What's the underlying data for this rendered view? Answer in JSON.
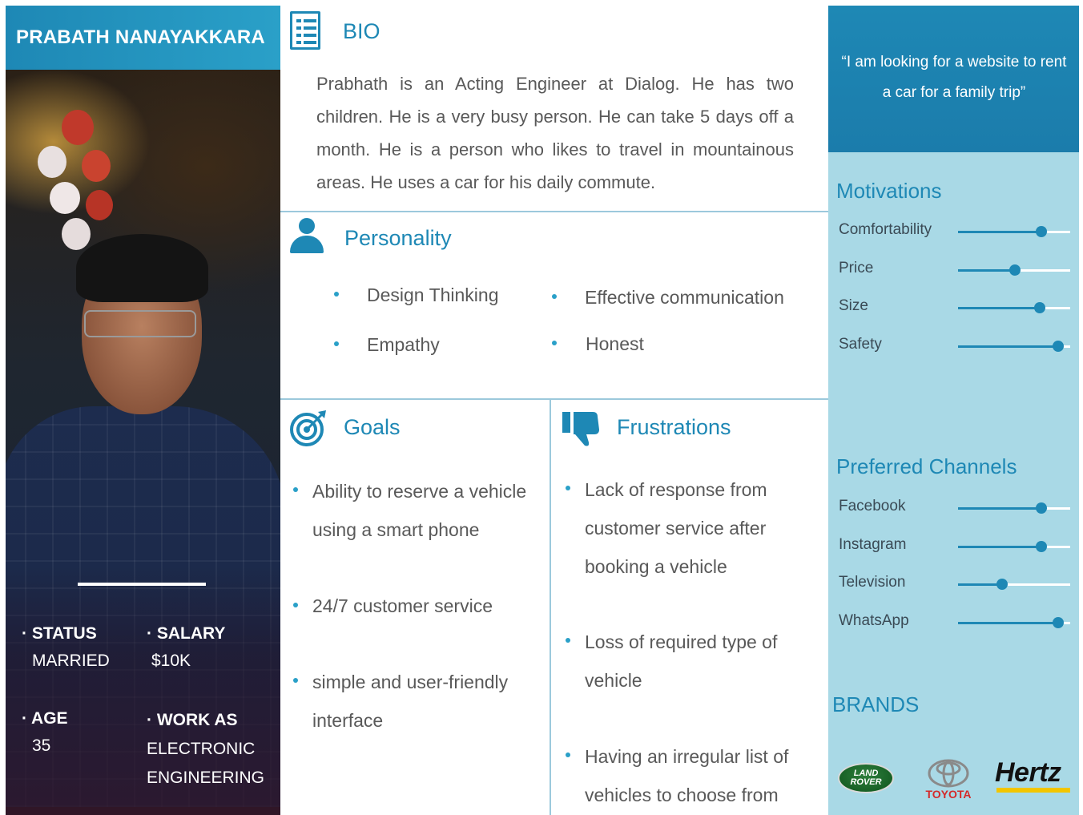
{
  "persona": {
    "name": "PRABATH NANAYAKKARA",
    "status_label": "· STATUS",
    "status_value": "MARRIED",
    "salary_label": "· SALARY",
    "salary_value": "$10K",
    "age_label": "· AGE",
    "age_value": "35",
    "work_label": "· WORK AS",
    "work_value_1": "ELECTRONIC",
    "work_value_2": "ENGINEERING"
  },
  "bio": {
    "title": "BIO",
    "text": "Prabhath is an Acting Engineer at Dialog. He has two children. He is a very busy person. He can take 5 days off a month. He is a person who likes to travel in mountainous areas. He uses a car for his daily commute."
  },
  "personality": {
    "title": "Personality",
    "traits": [
      "Design Thinking",
      "Empathy",
      "Effective communication",
      "Honest"
    ]
  },
  "goals": {
    "title": "Goals",
    "items": [
      [
        "Ability to reserve a vehicle",
        "using a smart phone"
      ],
      [
        "24/7 customer service"
      ],
      [
        "simple and user-friendly",
        "interface"
      ]
    ]
  },
  "frustrations": {
    "title": "Frustrations",
    "items": [
      [
        "Lack of response from",
        "customer service after",
        "booking a vehicle"
      ],
      [
        "Loss of required type of",
        "vehicle"
      ],
      [
        "Having an irregular list of",
        "vehicles to choose from"
      ]
    ]
  },
  "quote": "“I am looking for a website to rent a car for a family trip”",
  "motivations": {
    "title": "Motivations",
    "items": [
      {
        "label": "Comfortability",
        "level": 0.74
      },
      {
        "label": "Price",
        "level": 0.51
      },
      {
        "label": "Size",
        "level": 0.73
      },
      {
        "label": "Safety",
        "level": 0.89
      }
    ]
  },
  "channels": {
    "title": "Preferred Channels",
    "items": [
      {
        "label": "Facebook",
        "level": 0.74
      },
      {
        "label": "Instagram",
        "level": 0.74
      },
      {
        "label": "Television",
        "level": 0.39
      },
      {
        "label": "WhatsApp",
        "level": 0.89
      }
    ]
  },
  "brands": {
    "title": "BRANDS",
    "land_rover_1": "LAND",
    "land_rover_2": "ROVER",
    "toyota": "TOYOTA",
    "hertz": "Hertz"
  },
  "colors": {
    "accent": "#1e88b5",
    "panel": "#a9d9e6",
    "hertz_yellow": "#f2c500",
    "toyota_red": "#d42a2a"
  },
  "icons": [
    "list-document-icon",
    "person-icon",
    "target-icon",
    "thumbs-down-icon"
  ]
}
